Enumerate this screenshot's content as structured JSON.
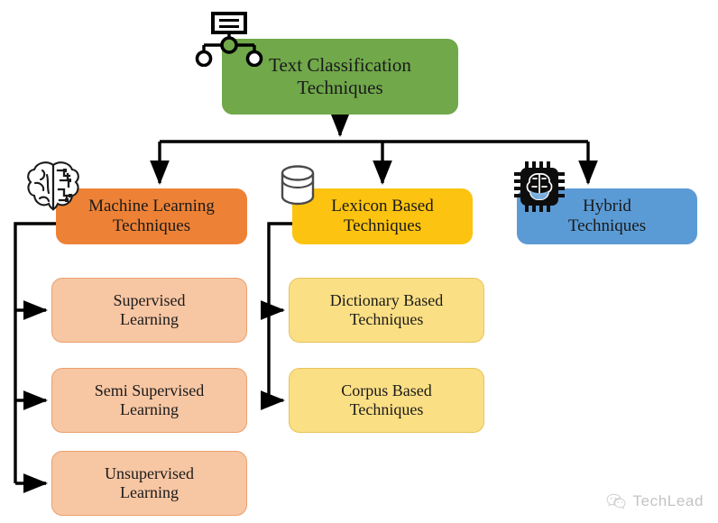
{
  "diagram": {
    "title": "Text Classification Techniques taxonomy",
    "root": {
      "label": "Text Classification\nTechniques",
      "line1": "Text Classification",
      "line2": "Techniques",
      "color": "#70A84A",
      "icon": "hierarchy-icon"
    },
    "branches": [
      {
        "id": "machine-learning",
        "line1": "Machine Learning",
        "line2": "Techniques",
        "color": "#ED8236",
        "icon": "brain-icon",
        "children": [
          {
            "id": "supervised",
            "line1": "Supervised",
            "line2": "Learning",
            "color": "#F7C6A3"
          },
          {
            "id": "semi-supervised",
            "line1": "Semi Supervised",
            "line2": "Learning",
            "color": "#F7C6A3"
          },
          {
            "id": "unsupervised",
            "line1": "Unsupervised",
            "line2": "Learning",
            "color": "#F7C6A3"
          }
        ]
      },
      {
        "id": "lexicon-based",
        "line1": "Lexicon Based",
        "line2": "Techniques",
        "color": "#FCC310",
        "icon": "database-icon",
        "children": [
          {
            "id": "dictionary-based",
            "line1": "Dictionary Based",
            "line2": "Techniques",
            "color": "#FBDF84"
          },
          {
            "id": "corpus-based",
            "line1": "Corpus Based",
            "line2": "Techniques",
            "color": "#FBDF84"
          }
        ]
      },
      {
        "id": "hybrid",
        "line1": "Hybrid",
        "line2": "Techniques",
        "color": "#5B9BD5",
        "icon": "ai-chip-icon",
        "children": []
      }
    ]
  },
  "watermark": {
    "text": "TechLead",
    "icon": "wechat-icon",
    "color": "#b9b9b9"
  },
  "colors": {
    "background": "#ffffff",
    "connector": "#000000",
    "root_green": "#70A84A",
    "ml_orange": "#ED8236",
    "lexicon_yellow": "#FCC310",
    "hybrid_blue": "#5B9BD5",
    "leaf_peach": "#F7C6A3",
    "leaf_light_yellow": "#FBDF84"
  }
}
